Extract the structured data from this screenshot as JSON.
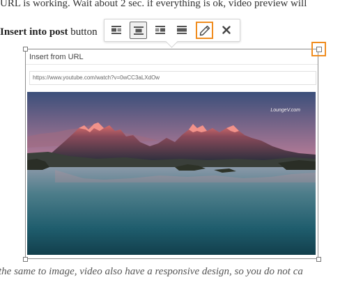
{
  "text": {
    "line1": "URL is working. Wait about 2 sec. if everything is ok, video preview will",
    "line2_bold": "Insert into post",
    "line2_rest": " button",
    "line_bottom": "the same to image, video also have a responsive design, so you do not ca"
  },
  "toolbar": {
    "buttons": [
      {
        "name": "align-left",
        "icon": "align-left-icon"
      },
      {
        "name": "align-center",
        "icon": "align-center-icon",
        "active": true
      },
      {
        "name": "align-right",
        "icon": "align-right-icon"
      },
      {
        "name": "align-none",
        "icon": "align-none-icon"
      },
      {
        "name": "edit",
        "icon": "pencil-icon",
        "highlighted": true
      },
      {
        "name": "remove",
        "icon": "close-icon"
      }
    ]
  },
  "embed": {
    "title": "Insert from URL",
    "url": "https://www.youtube.com/watch?v=0wCC3aLXdOw",
    "watermark": "LoungeV.com"
  },
  "colors": {
    "highlight": "#f08c1e",
    "frame_border": "#8c8c8c"
  }
}
